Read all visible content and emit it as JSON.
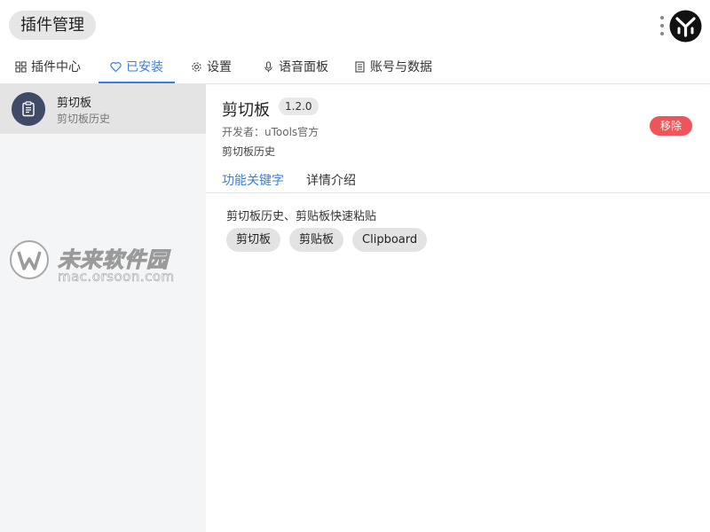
{
  "header": {
    "title": "插件管理"
  },
  "tabs": [
    {
      "label": "插件中心",
      "icon": "grid-icon",
      "active": false
    },
    {
      "label": "已安装",
      "icon": "heart-icon",
      "active": true
    },
    {
      "label": "设置",
      "icon": "gear-icon",
      "active": false
    },
    {
      "label": "语音面板",
      "icon": "microphone-icon",
      "active": false
    },
    {
      "label": "账号与数据",
      "icon": "document-icon",
      "active": false
    }
  ],
  "sidebar": {
    "items": [
      {
        "name": "剪切板",
        "desc": "剪切板历史",
        "icon": "clipboard-icon",
        "selected": true
      }
    ]
  },
  "watermark": {
    "title": "未来软件园",
    "subtitle": "mac.orsoon.com"
  },
  "detail": {
    "name": "剪切板",
    "version": "1.2.0",
    "developer": "开发者：uTools官方",
    "description": "剪切板历史",
    "remove_label": "移除",
    "subtabs": [
      {
        "label": "功能关键字",
        "active": true
      },
      {
        "label": "详情介绍",
        "active": false
      }
    ],
    "keywords_desc": "剪切板历史、剪贴板快速粘贴",
    "keywords": [
      "剪切板",
      "剪贴板",
      "Clipboard"
    ]
  },
  "colors": {
    "accent": "#3b7ddd",
    "danger": "#f0545b",
    "avatar_bg": "#3e4a67"
  }
}
